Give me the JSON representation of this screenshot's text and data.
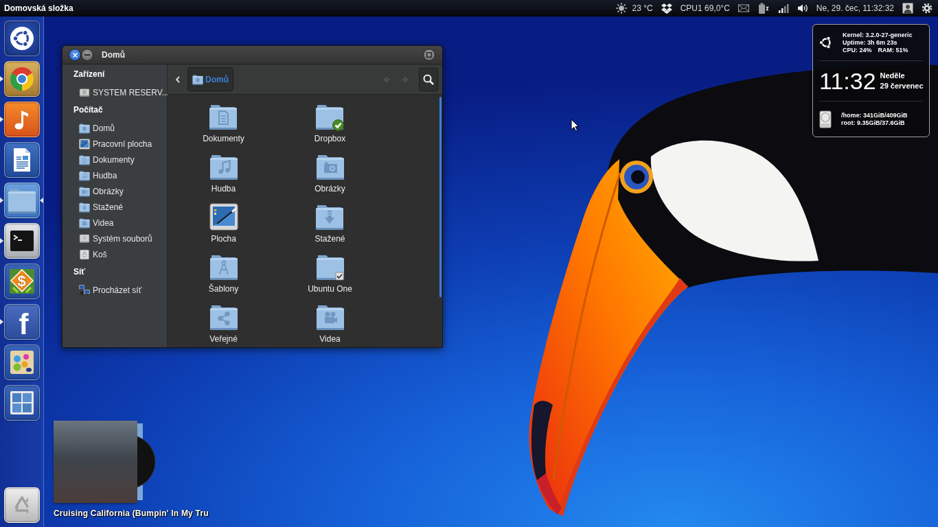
{
  "top_panel": {
    "title": "Domovská složka",
    "indicators": [
      {
        "kind": "weather",
        "text": "23 °C"
      },
      {
        "kind": "dropbox"
      },
      {
        "kind": "cpu",
        "text": "CPU1 69,0°C"
      },
      {
        "kind": "mail"
      },
      {
        "kind": "battery"
      },
      {
        "kind": "network"
      },
      {
        "kind": "sound"
      },
      {
        "kind": "clock",
        "text": "Ne, 29. čec, 11:32:32"
      },
      {
        "kind": "user"
      },
      {
        "kind": "settings"
      }
    ]
  },
  "launcher": {
    "items": [
      {
        "kind": "dash",
        "running": false,
        "focused": false
      },
      {
        "kind": "browser",
        "running": true,
        "focused": false
      },
      {
        "kind": "music",
        "running": true,
        "focused": false
      },
      {
        "kind": "writer",
        "running": false,
        "focused": false
      },
      {
        "kind": "files",
        "running": true,
        "focused": true
      },
      {
        "kind": "terminal",
        "running": true,
        "focused": false
      },
      {
        "kind": "finance",
        "glyph": "$",
        "running": false,
        "focused": false
      },
      {
        "kind": "facebook",
        "glyph": "f",
        "running": true,
        "focused": false
      },
      {
        "kind": "paint",
        "running": false,
        "focused": false
      },
      {
        "kind": "workspaces",
        "running": false,
        "focused": false
      },
      {
        "kind": "trash",
        "running": false,
        "focused": false
      }
    ]
  },
  "file_manager": {
    "title": "Domů",
    "sidebar": [
      {
        "heading": "Zařízení",
        "items": [
          {
            "label": "SYSTEM RESERV...",
            "kind": "drive"
          }
        ]
      },
      {
        "heading": "Počítač",
        "items": [
          {
            "label": "Domů",
            "kind": "home"
          },
          {
            "label": "Pracovní plocha",
            "kind": "desktop"
          },
          {
            "label": "Dokumenty",
            "kind": "documents"
          },
          {
            "label": "Hudba",
            "kind": "music"
          },
          {
            "label": "Obrázky",
            "kind": "pictures"
          },
          {
            "label": "Stažené",
            "kind": "downloads"
          },
          {
            "label": "Videa",
            "kind": "videos"
          },
          {
            "label": "Systém souborů",
            "kind": "filesystem"
          },
          {
            "label": "Koš",
            "kind": "trash"
          }
        ]
      },
      {
        "heading": "Síť",
        "items": [
          {
            "label": "Procházet síť",
            "kind": "network"
          }
        ]
      }
    ],
    "toolbar": {
      "path": [
        {
          "label": "Domů",
          "selected": true
        }
      ],
      "history": [
        {
          "kind": "back",
          "disabled": true
        },
        {
          "kind": "forward",
          "disabled": true
        }
      ]
    },
    "items": [
      {
        "label": "Dokumenty",
        "kind": "documents"
      },
      {
        "label": "Dropbox",
        "kind": "dropbox"
      },
      {
        "label": "Hudba",
        "kind": "music"
      },
      {
        "label": "Obrázky",
        "kind": "pictures"
      },
      {
        "label": "Plocha",
        "kind": "desktop"
      },
      {
        "label": "Stažené",
        "kind": "downloads"
      },
      {
        "label": "Šablony",
        "kind": "templates"
      },
      {
        "label": "Ubuntu One",
        "kind": "ubuntu_one"
      },
      {
        "label": "Veřejné",
        "kind": "public"
      },
      {
        "label": "Videa",
        "kind": "videos"
      }
    ]
  },
  "system_monitor": {
    "info_lines": [
      "Kernel: 3.2.0-27-generic",
      "Uptime: 3h 6m 23s"
    ],
    "cpu": "CPU: 24%",
    "ram": "RAM: 51%",
    "time": "11:32",
    "weekday": "Neděle",
    "date": "29 červenec",
    "disk_lines": [
      "/home: 341GiB/409GiB",
      "root: 9.35GiB/37.6GiB"
    ]
  },
  "music_widget": {
    "track_title": "Cruising California (Bumpin' In My Tru"
  }
}
